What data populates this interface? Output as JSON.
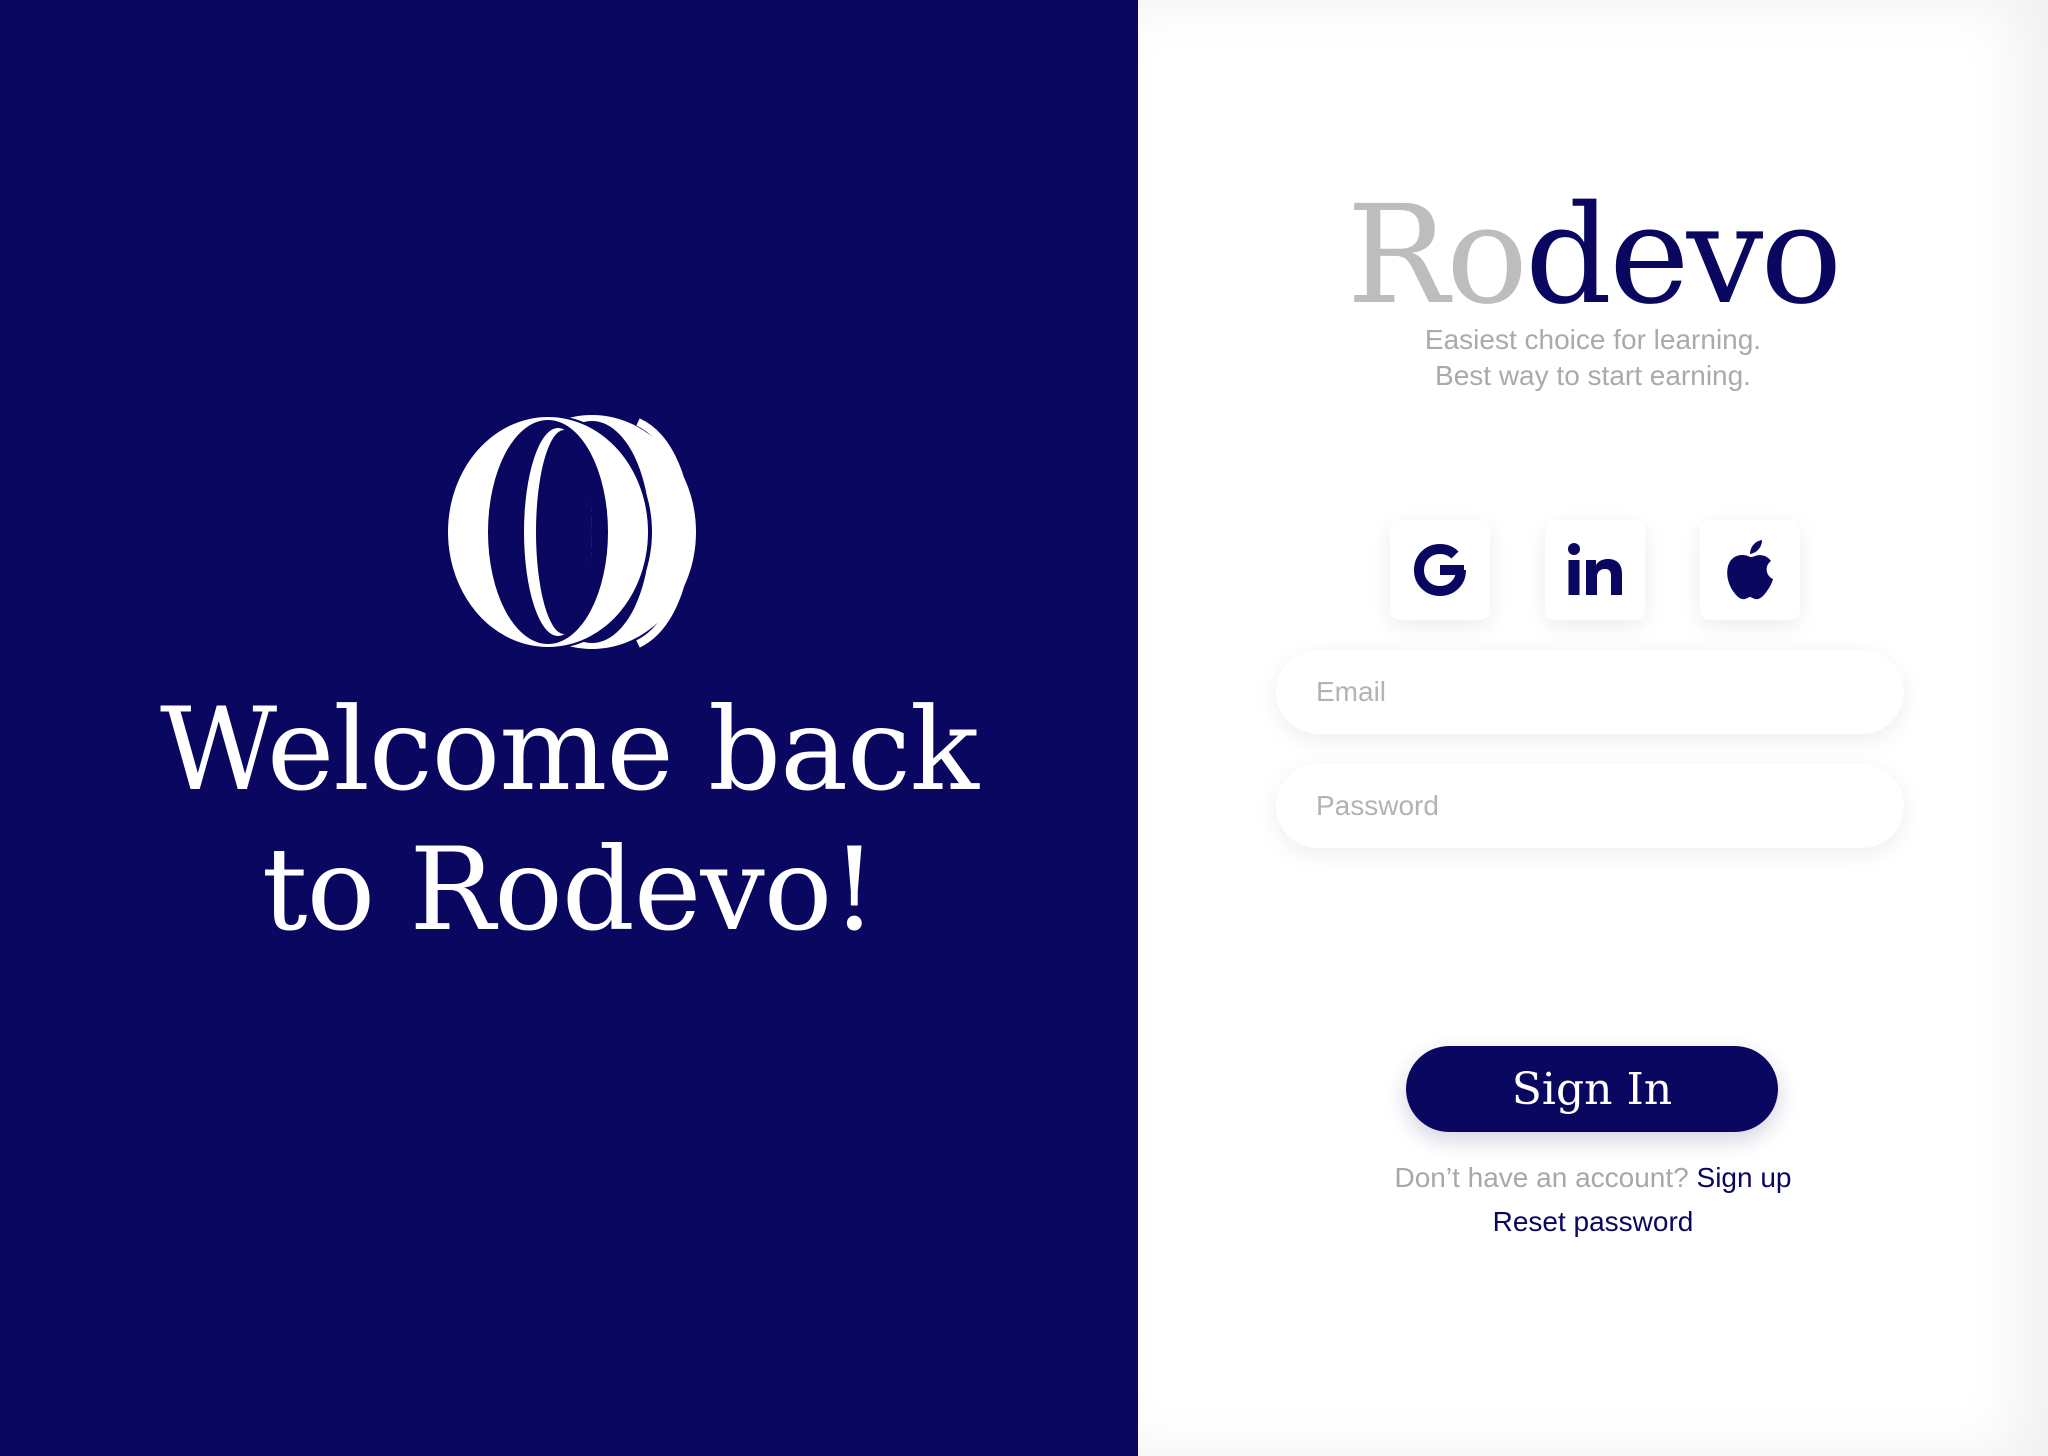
{
  "colors": {
    "navy": "#090760",
    "white": "#ffffff",
    "muted_text": "#aaaaaa",
    "brand_gray": "#bdbdbd"
  },
  "left_panel": {
    "welcome_line1": "Welcome back",
    "welcome_line2": "to Rodevo!",
    "logo_icon": "double-o-logo-icon"
  },
  "right_panel": {
    "brand_part1": "Ro",
    "brand_part2": "devo",
    "tagline_line1": "Easiest choice for learning.",
    "tagline_line2": "Best way to start earning.",
    "social": {
      "google_icon": "google-icon",
      "linkedin_icon": "linkedin-icon",
      "apple_icon": "apple-icon"
    },
    "email": {
      "placeholder": "Email",
      "value": ""
    },
    "password": {
      "placeholder": "Password",
      "value": ""
    },
    "signin_label": "Sign In",
    "no_account_text": "Don’t have an account?",
    "signup_label": "Sign up",
    "reset_label": "Reset password"
  }
}
